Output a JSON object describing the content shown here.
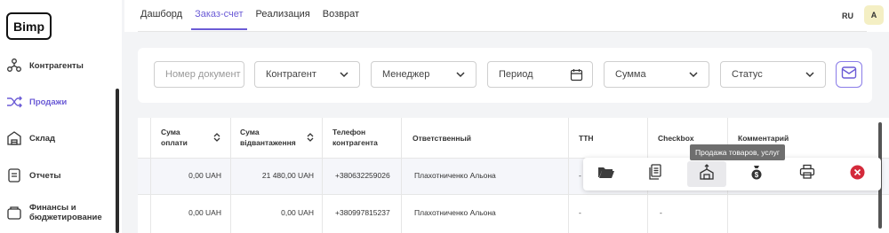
{
  "app": {
    "logo": "Bimp"
  },
  "sidebar": {
    "items": [
      {
        "label": "Контрагенты",
        "icon": "contacts-icon",
        "active": false
      },
      {
        "label": "Продажи",
        "icon": "shuffle-icon",
        "active": true
      },
      {
        "label": "Склад",
        "icon": "warehouse-icon",
        "active": false
      },
      {
        "label": "Отчеты",
        "icon": "report-icon",
        "active": false
      },
      {
        "label": "Финансы и бюджетирование",
        "icon": "wallet-icon",
        "active": false
      }
    ]
  },
  "header": {
    "tabs": [
      "Дашборд",
      "Заказ-счет",
      "Реализация",
      "Возврат"
    ],
    "active_tab": "Заказ-счет",
    "lang": "RU",
    "avatar": "A"
  },
  "filters": {
    "doc_number_placeholder": "Номер документ",
    "counterparty": "Контрагент",
    "manager": "Менеджер",
    "period": "Период",
    "sum": "Сумма",
    "status": "Статус"
  },
  "table": {
    "headers": {
      "payment_sum": "Сума оплати",
      "shipment_sum": "Сума відвантаження",
      "phone": "Телефон контрагента",
      "responsible": "Ответственный",
      "ttn": "ТТН",
      "checkbox": "Checkbox",
      "comment": "Комментарий"
    },
    "rows": [
      {
        "payment_sum": "0,00 UAH",
        "shipment_sum": "21 480,00 UAH",
        "phone": "+380632259026",
        "responsible": "Плахотниченко Альона",
        "ttn": "-",
        "checkbox": "",
        "comment": ""
      },
      {
        "payment_sum": "0,00 UAH",
        "shipment_sum": "0,00 UAH",
        "phone": "+380997815237",
        "responsible": "Плахотниченко Альона",
        "ttn": "-",
        "checkbox": "-",
        "comment": ""
      }
    ]
  },
  "actions": {
    "tooltip": "Продажа товаров, услуг",
    "items": [
      "open-folder-icon",
      "copy-document-icon",
      "sale-goods-icon",
      "payment-icon",
      "print-icon",
      "delete-icon"
    ]
  },
  "colors": {
    "accent": "#6b5bd6",
    "danger": "#d42a3b"
  }
}
